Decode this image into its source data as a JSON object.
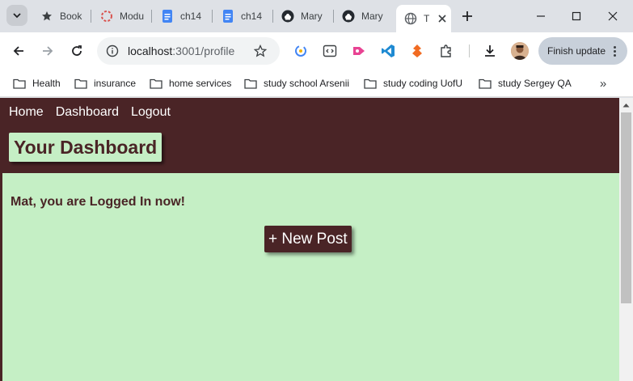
{
  "browser": {
    "tabs": [
      {
        "title": "Book",
        "icon": "star-icon"
      },
      {
        "title": "Modu",
        "icon": "module-icon"
      },
      {
        "title": "ch14",
        "icon": "docs-icon"
      },
      {
        "title": "ch14",
        "icon": "docs-icon"
      },
      {
        "title": "Mary",
        "icon": "github-icon"
      },
      {
        "title": "Mary",
        "icon": "github-icon"
      },
      {
        "title": "T",
        "icon": "globe-icon",
        "active": true
      }
    ],
    "url_host": "localhost",
    "url_path": ":3001/profile",
    "finish_update_label": "Finish update",
    "bookmarks": [
      {
        "label": "Health"
      },
      {
        "label": "insurance"
      },
      {
        "label": "home services"
      },
      {
        "label": "study school Arsenii"
      },
      {
        "label": "study coding UofU"
      },
      {
        "label": "study Sergey QA"
      }
    ],
    "bookmarks_more": "»"
  },
  "page": {
    "nav": {
      "home": "Home",
      "dashboard": "Dashboard",
      "logout": "Logout"
    },
    "title": "Your Dashboard",
    "welcome": "Mat, you are Logged In now!",
    "new_post_label": "+ New Post"
  },
  "colors": {
    "header_bg": "#4a2426",
    "content_bg": "#c5efc5",
    "chrome_bg": "#dee1e6"
  }
}
